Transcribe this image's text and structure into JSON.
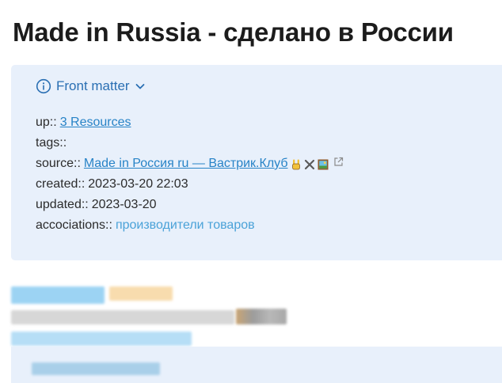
{
  "page": {
    "title": "Made in Russia - сделано в России"
  },
  "front_matter": {
    "label": "Front matter",
    "icons": {
      "info": "info-circle-icon",
      "toggle": "chevron-down-icon"
    },
    "up": {
      "key": "up::",
      "value": "3 Resources"
    },
    "tags": {
      "key": "tags::"
    },
    "source": {
      "key": "source::",
      "value": "Made in Россия ru — Вастрик.Клуб",
      "emoji": [
        "rock-hand-icon",
        "crossed-swords-icon",
        "framed-picture-icon"
      ],
      "external_icon": "external-link-icon"
    },
    "created": {
      "key": "created::",
      "value": "2023-03-20 22:03"
    },
    "updated": {
      "key": "updated::",
      "value": "2023-03-20"
    },
    "associations": {
      "key": "accociations::",
      "value": "производители товаров"
    }
  },
  "colors": {
    "accent": "#2783c7",
    "header_blue": "#2a6fb3",
    "panel_bg": "#e8f0fb",
    "tag_link": "#4aa2d8"
  }
}
